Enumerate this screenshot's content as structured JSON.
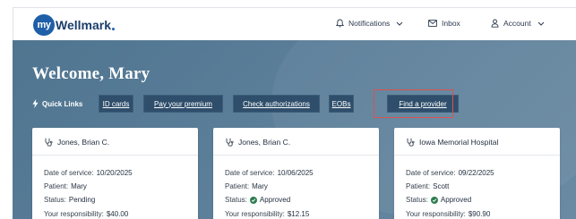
{
  "brand": {
    "badge": "my",
    "name": "Wellmark"
  },
  "nav": {
    "notifications": "Notifications",
    "inbox": "Inbox",
    "account": "Account"
  },
  "welcome": "Welcome, Mary",
  "quick_links": {
    "label": "Quick Links",
    "items": [
      "ID cards",
      "Pay your premium",
      "Check authorizations",
      "EOBs",
      "Find a provider"
    ]
  },
  "cards": [
    {
      "name": "Jones, Brian C.",
      "date_label": "Date of service:",
      "date": "10/20/2025",
      "patient_label": "Patient:",
      "patient": "Mary",
      "status_label": "Status:",
      "status": "Pending",
      "resp_label": "Your responsibility:",
      "resp": "$40.00"
    },
    {
      "name": "Jones, Brian C.",
      "date_label": "Date of service:",
      "date": "10/06/2025",
      "patient_label": "Patient:",
      "patient": "Mary",
      "status_label": "Status:",
      "status": "Approved",
      "resp_label": "Your responsibility:",
      "resp": "$12.15"
    },
    {
      "name": "Iowa Memorial Hospital",
      "date_label": "Date of service:",
      "date": "09/22/2025",
      "patient_label": "Patient:",
      "patient": "Scott",
      "status_label": "Status:",
      "status": "Approved",
      "resp_label": "Your responsibility:",
      "resp": "$90.90"
    }
  ],
  "icons": {
    "notifications": "bell-icon",
    "inbox": "mail-icon",
    "account": "person-icon",
    "quick_links": "lightning-icon",
    "provider": "stethoscope-icon",
    "approved": "check-circle-icon"
  },
  "colors": {
    "accent": "#1f5fa8",
    "hero": "#5a7d98",
    "button": "#2e4e6b",
    "highlight": "#d9534f",
    "approved": "#2e7d4f"
  }
}
